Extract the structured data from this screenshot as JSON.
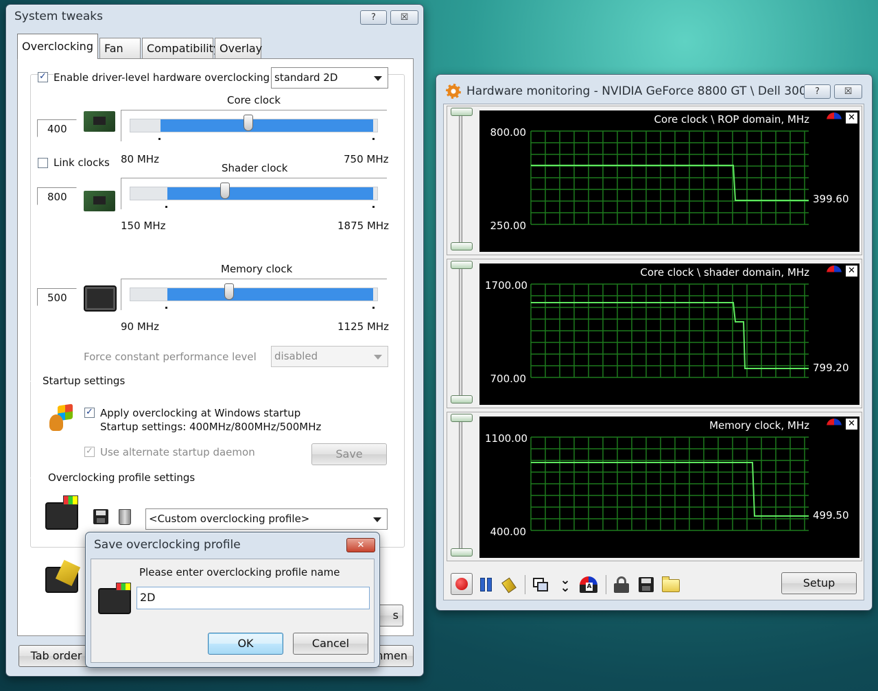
{
  "system_tweaks": {
    "title": "System tweaks",
    "title_buttons": [
      "?",
      "☒"
    ],
    "tabs": [
      "Overclocking",
      "Fan",
      "Compatibility",
      "Overlay"
    ],
    "enable_label": "Enable driver-level hardware overclocking",
    "enable_checked": true,
    "mode_select": "standard 2D",
    "core": {
      "title": "Core clock",
      "value": "400",
      "min_label": "80 MHz",
      "max_label": "750 MHz",
      "level": 0.48
    },
    "link_clocks": {
      "label": "Link clocks",
      "checked": false
    },
    "shader": {
      "title": "Shader clock",
      "value": "800",
      "min_label": "150 MHz",
      "max_label": "1875 MHz",
      "level": 0.38
    },
    "memory": {
      "title": "Memory clock",
      "value": "500",
      "min_label": "90 MHz",
      "max_label": "1125 MHz",
      "level": 0.4
    },
    "force_label": "Force constant performance level",
    "force_select": "disabled",
    "startup_header": "Startup settings",
    "apply_label": "Apply overclocking at Windows startup",
    "apply_checked": true,
    "startup_text": "Startup settings: 400MHz/800MHz/500MHz",
    "daemon_label": "Use alternate startup daemon",
    "save_button": "Save",
    "profile_header": "Overclocking profile settings",
    "profile_select": "<Custom overclocking profile>",
    "tab_order_button": "Tab order",
    "partial_button_right": "s",
    "partial_button_bottom": "hmen"
  },
  "dialog": {
    "title": "Save overclocking profile",
    "close": "✕",
    "prompt": "Please enter overclocking profile name",
    "input_value": "2D",
    "ok": "OK",
    "cancel": "Cancel"
  },
  "monitor": {
    "title": "Hardware monitoring - NVIDIA GeForce 8800 GT  \\ Dell 300...",
    "title_buttons": [
      "?",
      "☒"
    ],
    "graphs": [
      {
        "title": "Core clock \\ ROP domain, MHz",
        "top": "800.00",
        "bottom": "250.00",
        "current": "399.60"
      },
      {
        "title": "Core clock \\ shader domain, MHz",
        "top": "1700.00",
        "bottom": "700.00",
        "current": "799.20"
      },
      {
        "title": "Memory clock, MHz",
        "top": "1100.00",
        "bottom": "400.00",
        "current": "499.50"
      }
    ],
    "setup_button": "Setup"
  }
}
